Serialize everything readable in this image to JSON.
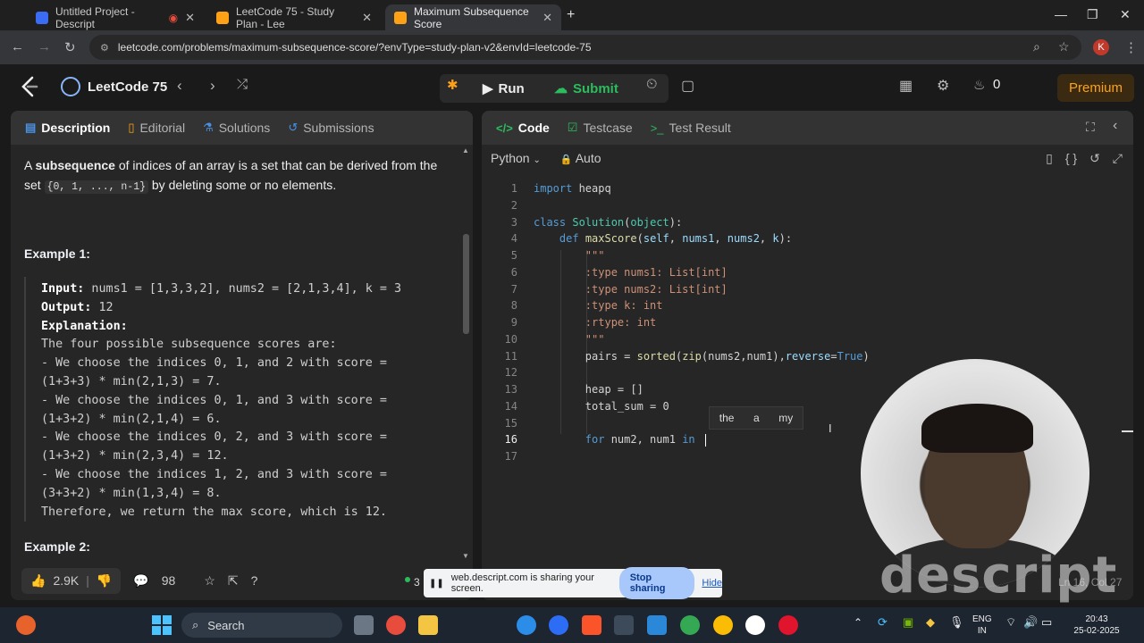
{
  "browser": {
    "tabs": [
      {
        "title": "Untitled Project - Descript",
        "active": false
      },
      {
        "title": "LeetCode 75 - Study Plan - Lee",
        "active": false
      },
      {
        "title": "Maximum Subsequence Score",
        "active": true
      }
    ],
    "new_tab": "+",
    "url": "leetcode.com/problems/maximum-subsequence-score/?envType=study-plan-v2&envId=leetcode-75",
    "profile_initial": "K",
    "window_controls": [
      "minimize",
      "maximize",
      "close"
    ]
  },
  "leetcode_nav": {
    "study_plan": "LeetCode 75",
    "run_label": "Run",
    "submit_label": "Submit",
    "streak_count": "0",
    "premium_label": "Premium"
  },
  "left_panel": {
    "tabs": [
      "Description",
      "Editorial",
      "Solutions",
      "Submissions"
    ],
    "text_a": "A",
    "text_subsequence": "subsequence",
    "text_rest1": " of indices of an array is a set that can be derived from the set",
    "set_code": "{0, 1, ..., n-1}",
    "text_rest2": " by deleting some or no elements.",
    "example1_title": "Example 1:",
    "example1": {
      "input_label": "Input:",
      "input_value": " nums1 = [1,3,3,2], nums2 = [2,1,3,4], k = 3",
      "output_label": "Output:",
      "output_value": " 12",
      "explanation_label": "Explanation:",
      "lines": [
        "The four possible subsequence scores are:",
        "- We choose the indices 0, 1, and 2 with score =",
        "(1+3+3) * min(2,1,3) = 7.",
        "- We choose the indices 0, 1, and 3 with score =",
        "(1+3+2) * min(2,1,4) = 6.",
        "- We choose the indices 0, 2, and 3 with score =",
        "(1+3+2) * min(2,3,4) = 12.",
        "- We choose the indices 1, 2, and 3 with score =",
        "(3+3+2) * min(1,3,4) = 8.",
        "Therefore, we return the max score, which is 12."
      ]
    },
    "example2_title": "Example 2:",
    "footer": {
      "likes": "2.9K",
      "comments": "98",
      "online": "3"
    }
  },
  "right_panel": {
    "tabs": [
      "Code",
      "Testcase",
      "Test Result"
    ],
    "language": "Python",
    "mode": "Auto",
    "status": "Ln 16, Col 27",
    "suggestions": [
      "the",
      "a",
      "my"
    ]
  },
  "share_bar": {
    "message": "web.descript.com is sharing your screen.",
    "stop_label": "Stop sharing",
    "hide_label": "Hide"
  },
  "watermark": "descript",
  "taskbar": {
    "search_label": "Search",
    "lang_top": "ENG",
    "lang_bottom": "IN",
    "time": "20:43",
    "date": "25-02-2025"
  }
}
